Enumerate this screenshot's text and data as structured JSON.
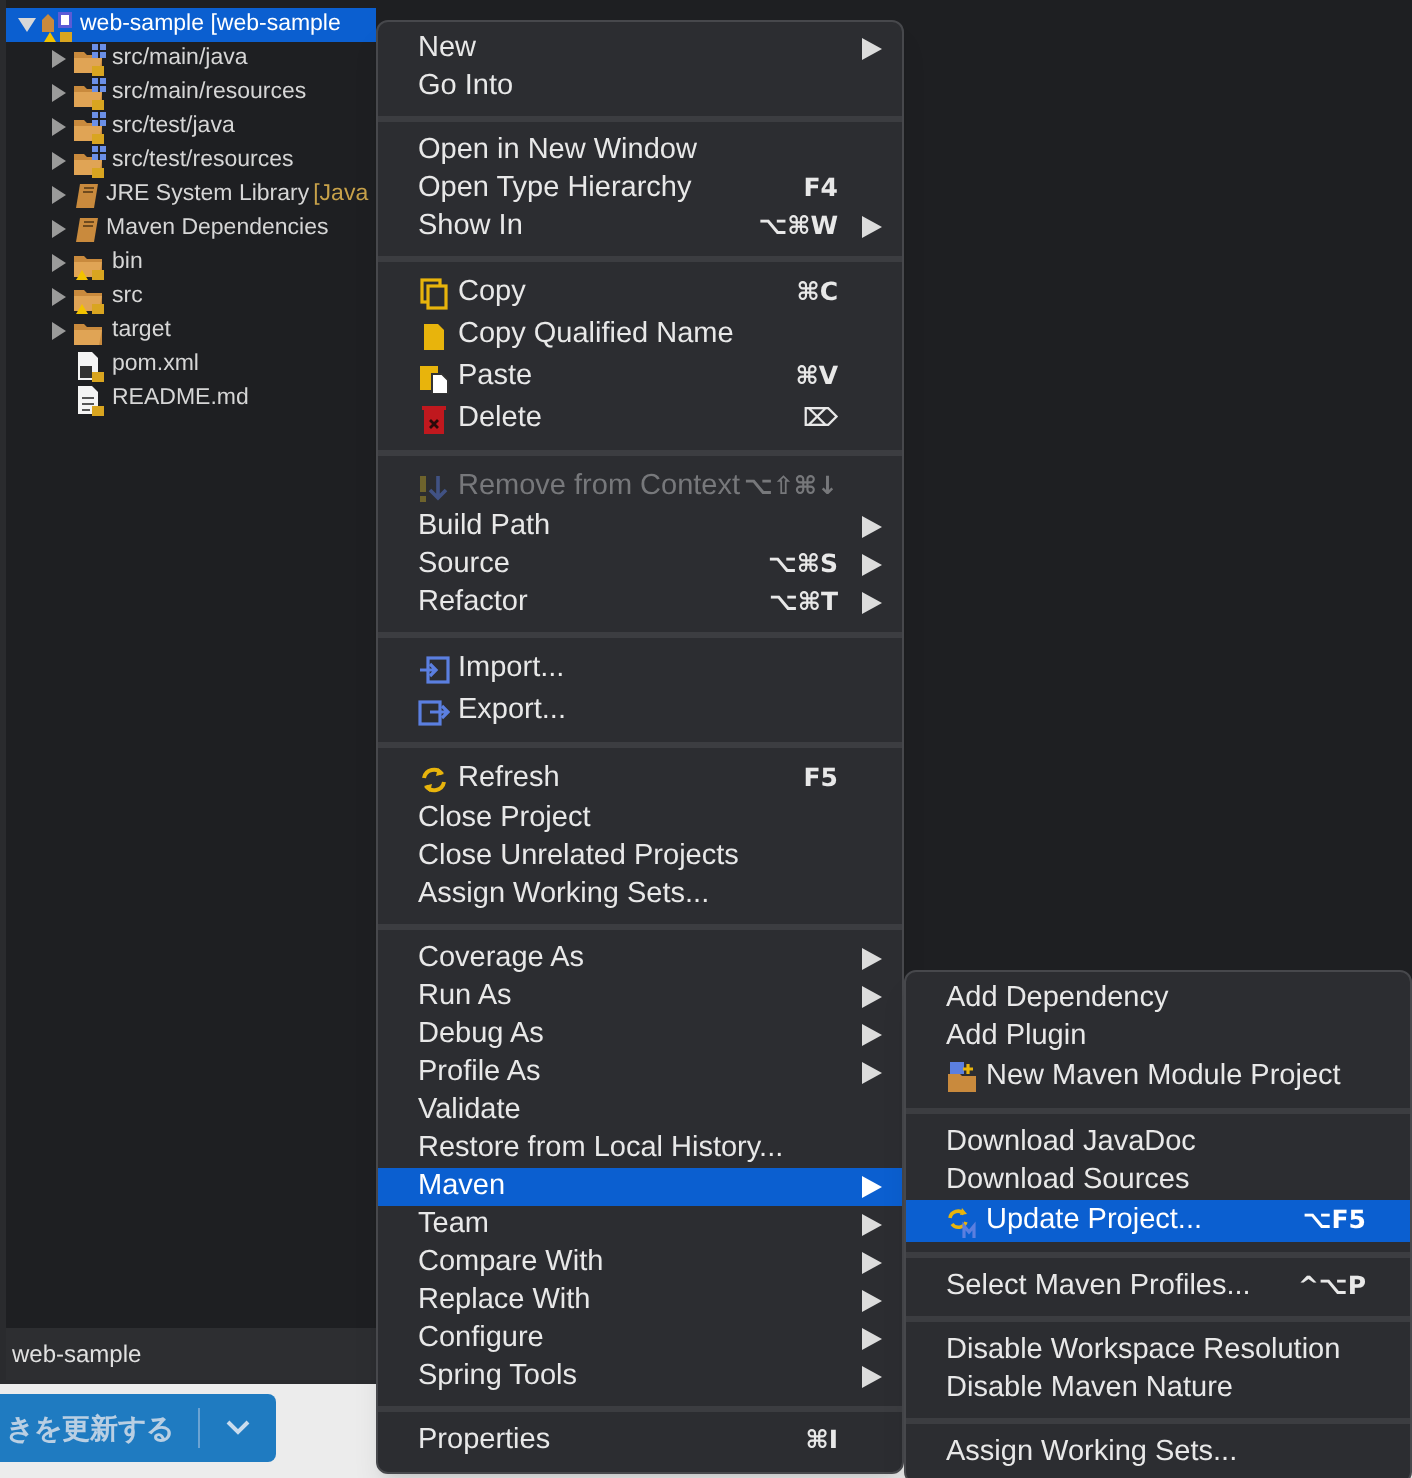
{
  "tree": {
    "root": {
      "label": "web-sample [web-sample",
      "kind": "project",
      "expanded": true,
      "selected": true,
      "children": [
        {
          "label": "src/main/java",
          "kind": "source",
          "expanded": false
        },
        {
          "label": "src/main/resources",
          "kind": "source",
          "expanded": false
        },
        {
          "label": "src/test/java",
          "kind": "source",
          "expanded": false
        },
        {
          "label": "src/test/resources",
          "kind": "source",
          "expanded": false
        },
        {
          "label": "JRE System Library",
          "decoration": "[Java",
          "kind": "library",
          "expanded": false
        },
        {
          "label": "Maven Dependencies",
          "kind": "library",
          "expanded": false
        },
        {
          "label": "bin",
          "kind": "warnfolder",
          "expanded": false
        },
        {
          "label": "src",
          "kind": "warnfolder",
          "expanded": false
        },
        {
          "label": "target",
          "kind": "folder",
          "expanded": false
        },
        {
          "label": "pom.xml",
          "kind": "pom"
        },
        {
          "label": "README.md",
          "kind": "file"
        }
      ]
    }
  },
  "status_bar": {
    "text": "web-sample"
  },
  "button": {
    "label": "きを更新する"
  },
  "context_menu": {
    "sections": [
      [
        {
          "label": "New",
          "kind": "text",
          "submenu": true,
          "selected": false,
          "disabled": false
        },
        {
          "label": "Go Into",
          "kind": "text",
          "submenu": false,
          "selected": false,
          "disabled": false
        }
      ],
      [
        {
          "label": "Open in New Window",
          "kind": "text",
          "submenu": false,
          "selected": false,
          "disabled": false
        },
        {
          "label": "Open Type Hierarchy",
          "kind": "text",
          "shortcut": "F4",
          "submenu": false,
          "selected": false,
          "disabled": false
        },
        {
          "label": "Show In",
          "kind": "text",
          "shortcut": "⌥⌘W",
          "submenu": true,
          "selected": false,
          "disabled": false
        }
      ],
      [
        {
          "label": "Copy",
          "kind": "copy",
          "shortcut": "⌘C",
          "submenu": false,
          "selected": false,
          "disabled": false
        },
        {
          "label": "Copy Qualified Name",
          "kind": "page",
          "submenu": false,
          "selected": false,
          "disabled": false
        },
        {
          "label": "Paste",
          "kind": "paste",
          "shortcut": "⌘V",
          "submenu": false,
          "selected": false,
          "disabled": false
        },
        {
          "label": "Delete",
          "kind": "trash",
          "shortcut": "⌦",
          "submenu": false,
          "selected": false,
          "disabled": false
        }
      ],
      [
        {
          "label": "Remove from Context",
          "kind": "remove",
          "shortcut": "⌥⇧⌘↓",
          "submenu": false,
          "selected": false,
          "disabled": true
        },
        {
          "label": "Build Path",
          "kind": "text",
          "submenu": true,
          "selected": false,
          "disabled": false
        },
        {
          "label": "Source",
          "kind": "text",
          "shortcut": "⌥⌘S",
          "submenu": true,
          "selected": false,
          "disabled": false
        },
        {
          "label": "Refactor",
          "kind": "text",
          "shortcut": "⌥⌘T",
          "submenu": true,
          "selected": false,
          "disabled": false
        }
      ],
      [
        {
          "label": "Import...",
          "kind": "import",
          "submenu": false,
          "selected": false,
          "disabled": false
        },
        {
          "label": "Export...",
          "kind": "export",
          "submenu": false,
          "selected": false,
          "disabled": false
        }
      ],
      [
        {
          "label": "Refresh",
          "kind": "refresh",
          "shortcut": "F5",
          "submenu": false,
          "selected": false,
          "disabled": false
        },
        {
          "label": "Close Project",
          "kind": "text",
          "submenu": false,
          "selected": false,
          "disabled": false
        },
        {
          "label": "Close Unrelated Projects",
          "kind": "text",
          "submenu": false,
          "selected": false,
          "disabled": false
        },
        {
          "label": "Assign Working Sets...",
          "kind": "text",
          "submenu": false,
          "selected": false,
          "disabled": false
        }
      ],
      [
        {
          "label": "Coverage As",
          "kind": "text",
          "submenu": true,
          "selected": false,
          "disabled": false
        },
        {
          "label": "Run As",
          "kind": "text",
          "submenu": true,
          "selected": false,
          "disabled": false
        },
        {
          "label": "Debug As",
          "kind": "text",
          "submenu": true,
          "selected": false,
          "disabled": false
        },
        {
          "label": "Profile As",
          "kind": "text",
          "submenu": true,
          "selected": false,
          "disabled": false
        },
        {
          "label": "Validate",
          "kind": "text",
          "submenu": false,
          "selected": false,
          "disabled": false
        },
        {
          "label": "Restore from Local History...",
          "kind": "text",
          "submenu": false,
          "selected": false,
          "disabled": false
        },
        {
          "label": "Maven",
          "kind": "text",
          "submenu": true,
          "selected": true,
          "disabled": false
        },
        {
          "label": "Team",
          "kind": "text",
          "submenu": true,
          "selected": false,
          "disabled": false
        },
        {
          "label": "Compare With",
          "kind": "text",
          "submenu": true,
          "selected": false,
          "disabled": false
        },
        {
          "label": "Replace With",
          "kind": "text",
          "submenu": true,
          "selected": false,
          "disabled": false
        },
        {
          "label": "Configure",
          "kind": "text",
          "submenu": true,
          "selected": false,
          "disabled": false
        },
        {
          "label": "Spring Tools",
          "kind": "text",
          "submenu": true,
          "selected": false,
          "disabled": false
        }
      ],
      [
        {
          "label": "Properties",
          "kind": "text",
          "shortcut": "⌘I",
          "submenu": false,
          "selected": false,
          "disabled": false
        }
      ]
    ]
  },
  "maven_submenu": {
    "sections": [
      [
        {
          "label": "Add Dependency",
          "kind": "text",
          "submenu": false,
          "selected": false,
          "disabled": false
        },
        {
          "label": "Add Plugin",
          "kind": "text",
          "submenu": false,
          "selected": false,
          "disabled": false
        },
        {
          "label": "New Maven Module Project",
          "kind": "module",
          "submenu": false,
          "selected": false,
          "disabled": false
        }
      ],
      [
        {
          "label": "Download JavaDoc",
          "kind": "text",
          "submenu": false,
          "selected": false,
          "disabled": false
        },
        {
          "label": "Download Sources",
          "kind": "text",
          "submenu": false,
          "selected": false,
          "disabled": false
        },
        {
          "label": "Update Project...",
          "kind": "update",
          "shortcut": "⌥F5",
          "submenu": false,
          "selected": true,
          "disabled": false
        }
      ],
      [
        {
          "label": "Select Maven Profiles...",
          "kind": "text",
          "shortcut": "^⌥P",
          "submenu": false,
          "selected": false,
          "disabled": false
        }
      ],
      [
        {
          "label": "Disable Workspace Resolution",
          "kind": "text",
          "submenu": false,
          "selected": false,
          "disabled": false
        },
        {
          "label": "Disable Maven Nature",
          "kind": "text",
          "submenu": false,
          "selected": false,
          "disabled": false
        }
      ],
      [
        {
          "label": "Assign Working Sets...",
          "kind": "text",
          "submenu": false,
          "selected": false,
          "disabled": false
        }
      ]
    ]
  }
}
